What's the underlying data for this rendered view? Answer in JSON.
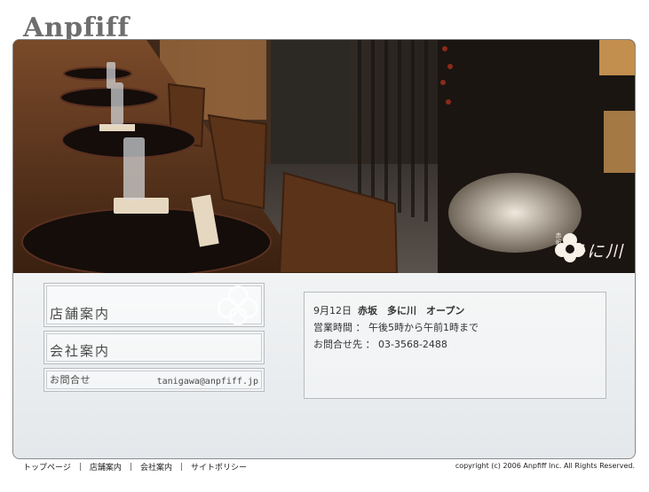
{
  "site": {
    "logo_text": "Anpfiff"
  },
  "hero": {
    "stamp_small": "赤坂",
    "stamp_name": "多に川",
    "colors": {
      "wood": "#6a3e22",
      "dark": "#1a120c",
      "warm_light": "#e0a45a"
    }
  },
  "menu": {
    "store_info": "店舗案内",
    "company_info": "会社案内",
    "contact_label": "お問合せ",
    "contact_email": "tanigawa@anpfiff.jp"
  },
  "info": {
    "headline_date": "9月12日",
    "headline_shop": "赤坂　多に川　オープン",
    "hours": "営業時間 ： 午後5時から午前1時まで",
    "phone": "お問合せ先 ： 03-3568-2488"
  },
  "footer": {
    "nav": [
      "トップページ",
      "店舗案内",
      "会社案内",
      "サイトポリシー"
    ],
    "separator": "|",
    "copyright": "copyright (c) 2006 Anpfiff Inc. All Rights Reserved."
  }
}
